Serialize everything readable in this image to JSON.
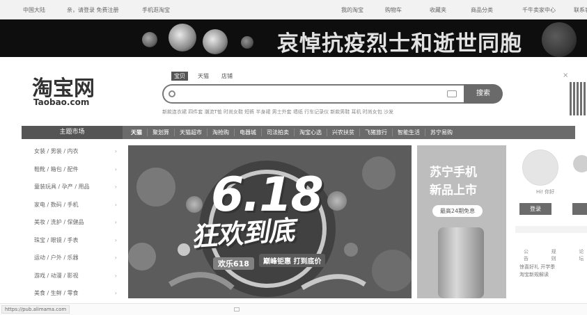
{
  "topbar": {
    "links": [
      "中国大陆",
      "亲，请登录 免费注册",
      "手机逛淘宝",
      "我的淘宝",
      "购物车",
      "收藏夹",
      "商品分类",
      "千牛卖家中心",
      "联系客服"
    ]
  },
  "mourning_banner": {
    "text": "哀悼抗疫烈士和逝世同胞"
  },
  "logo": {
    "cn": "淘宝网",
    "en": "Taobao.com"
  },
  "search": {
    "tabs": [
      "宝贝",
      "天猫",
      "店铺"
    ],
    "placeholder": "",
    "button": "搜索",
    "hot_words": "新款连衣裙 四件套 潮流T恤 时尚女鞋 短裤 半身裙 男士外套 墙纸 行车记录仪 新款男鞋 耳机 时尚女包 沙发"
  },
  "nav": {
    "category_title": "主题市场",
    "items": [
      "天猫",
      "聚划算",
      "天猫超市",
      "淘抢购",
      "电器城",
      "司法拍卖",
      "淘宝心选",
      "兴农扶贫",
      "飞猪旅行",
      "智能生活",
      "苏宁易购"
    ]
  },
  "sidebar": {
    "rows": [
      "女装 / 男装 / 内衣",
      "鞋靴 / 箱包 / 配件",
      "童装玩具 / 孕产 / 用品",
      "家电 / 数码 / 手机",
      "美妆 / 洗护 / 保健品",
      "珠宝 / 眼镜 / 手表",
      "运动 / 户外 / 乐器",
      "游戏 / 动漫 / 影视",
      "美食 / 生鲜 / 零食"
    ]
  },
  "banner": {
    "title_num": "6.18",
    "title_main": "狂欢到底",
    "tag1": "欢乐618",
    "tag2": "巅峰钜惠 打到底价",
    "colors": {
      "bg": "#7d4de8",
      "accent": "#2f8de8",
      "pink": "#e2316f"
    }
  },
  "promo": {
    "line1": "苏宁手机",
    "line2": "新品上市",
    "button": "最高24期免息"
  },
  "user": {
    "greeting": "Hi! 你好",
    "login": "登录",
    "tabs": [
      "公告",
      "规则",
      "论坛"
    ],
    "news": [
      "惊喜好礼 开学季",
      "淘宝新规解读"
    ]
  },
  "status": {
    "url": "https://pub.alimama.com"
  }
}
